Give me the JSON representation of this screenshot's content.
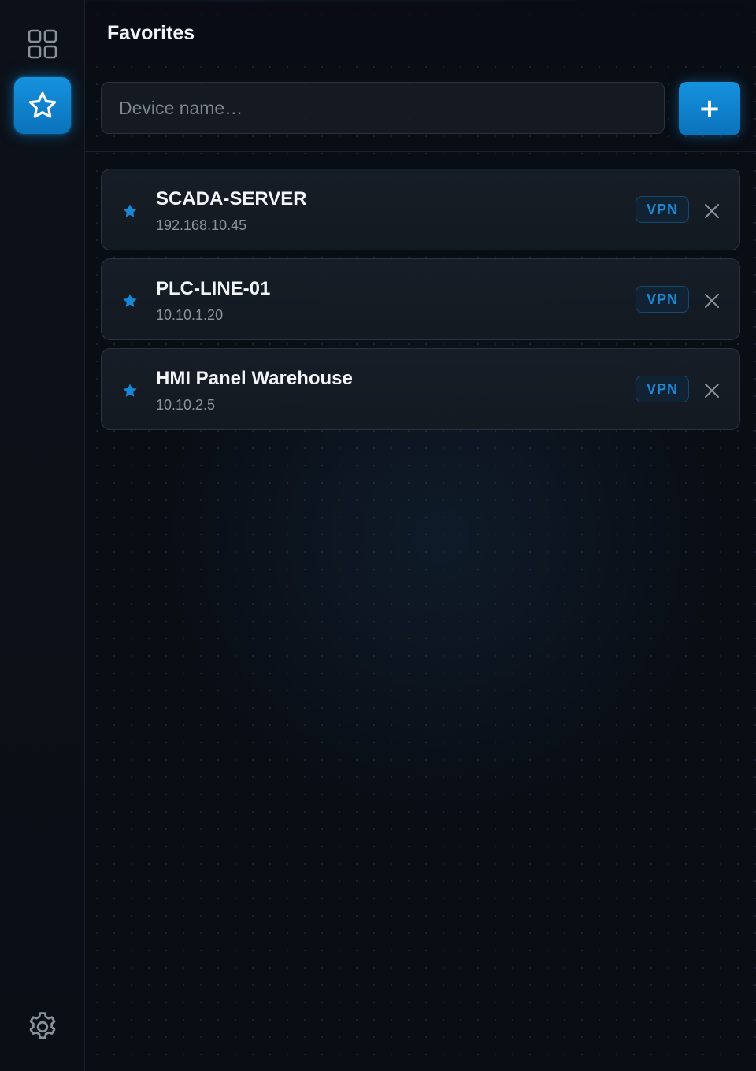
{
  "header": {
    "title": "Favorites"
  },
  "sidebar": {
    "items": [
      {
        "name": "grid",
        "icon": "grid-icon",
        "active": false
      },
      {
        "name": "favorites",
        "icon": "star-icon",
        "active": true
      },
      {
        "name": "settings",
        "icon": "gear-icon",
        "active": false
      }
    ]
  },
  "toolbar": {
    "search_placeholder": "Device name…",
    "add_label": "+"
  },
  "favorites": [
    {
      "name": "SCADA-SERVER",
      "ip": "192.168.10.45",
      "vpn_label": "VPN"
    },
    {
      "name": "PLC-LINE-01",
      "ip": "10.10.1.20",
      "vpn_label": "VPN"
    },
    {
      "name": "HMI Panel Warehouse",
      "ip": "10.10.2.5",
      "vpn_label": "VPN"
    }
  ],
  "colors": {
    "accent": "#1592de",
    "background": "#090d14",
    "card": "#181e27",
    "text": "#f2f5f8",
    "muted": "#8b939c"
  }
}
